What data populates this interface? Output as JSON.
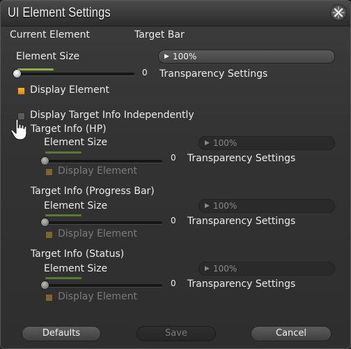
{
  "window": {
    "title": "UI Element Settings"
  },
  "header": {
    "left_label": "Current Element",
    "right_label": "Target Bar"
  },
  "main": {
    "size_label": "Element Size",
    "size_value": "0",
    "size_level": 0.0,
    "transparency_label": "Transparency Settings",
    "transparency_value": "100%",
    "display_label": "Display Element",
    "display_checked": true,
    "independent_label": "Display Target Info Independently",
    "independent_checked": false
  },
  "sections": [
    {
      "title": "Target Info (HP)",
      "size_label": "Element Size",
      "size_value": "0",
      "transparency_label": "Transparency Settings",
      "transparency_value": "100%",
      "display_label": "Display Element",
      "enabled": false
    },
    {
      "title": "Target Info (Progress Bar)",
      "size_label": "Element Size",
      "size_value": "0",
      "transparency_label": "Transparency Settings",
      "transparency_value": "100%",
      "display_label": "Display Element",
      "enabled": false
    },
    {
      "title": "Target Info (Status)",
      "size_label": "Element Size",
      "size_value": "0",
      "transparency_label": "Transparency Settings",
      "transparency_value": "100%",
      "display_label": "Display Element",
      "enabled": false
    }
  ],
  "footer": {
    "defaults_label": "Defaults",
    "save_label": "Save",
    "cancel_label": "Cancel"
  },
  "colors": {
    "accent_green": "#8fb040",
    "checkbox_orange": "#e8a026",
    "panel": "#333333"
  }
}
